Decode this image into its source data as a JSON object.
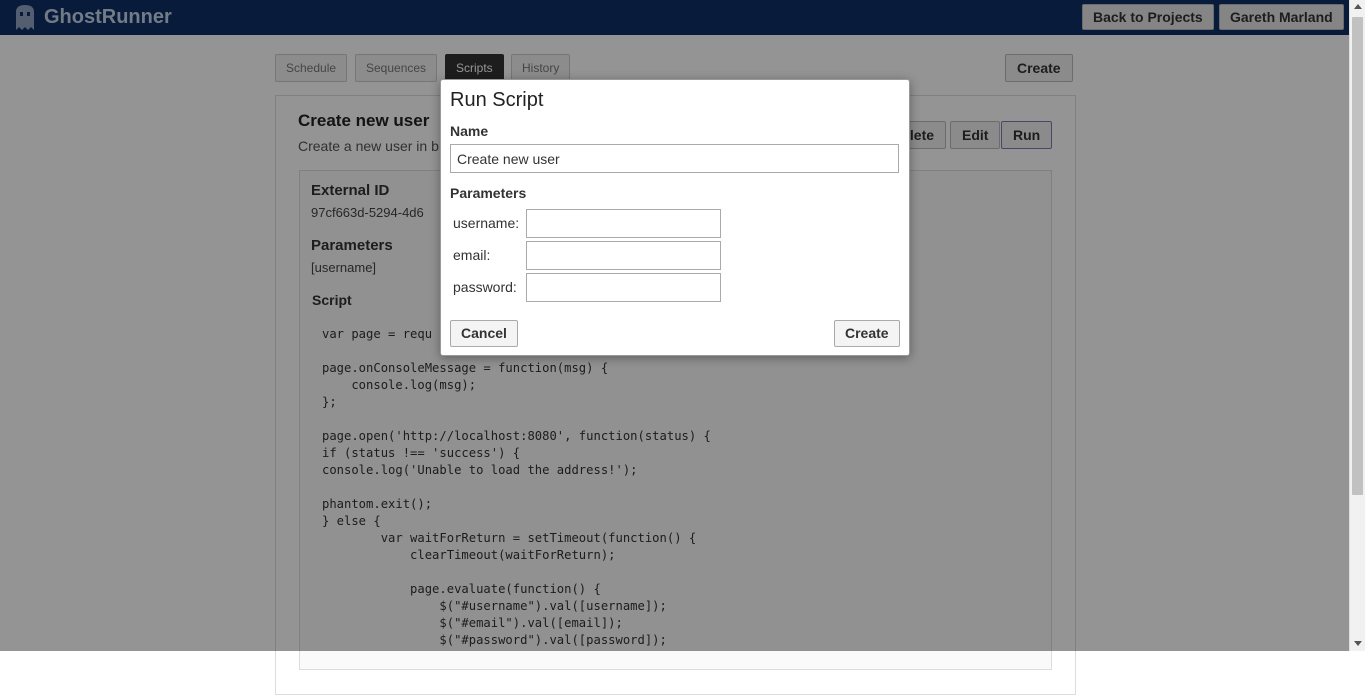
{
  "header": {
    "app_name": "GhostRunner",
    "back_label": "Back to Projects",
    "user_label": "Gareth Marland"
  },
  "tabs": [
    "Schedule",
    "Sequences",
    "Scripts",
    "History"
  ],
  "actions": {
    "create_label": "Create",
    "delete_label": "Delete",
    "edit_label": "Edit",
    "run_label": "Run"
  },
  "script": {
    "title": "Create new user",
    "description": "Create a new user in b",
    "external_id_label": "External ID",
    "external_id": "97cf663d-5294-4d6",
    "parameters_label": "Parameters",
    "parameters_value": "[username]",
    "script_label": "Script",
    "code": "var page = requ\n\npage.onConsoleMessage = function(msg) {\n    console.log(msg);\n};\n\npage.open('http://localhost:8080', function(status) {\nif (status !== 'success') {\nconsole.log('Unable to load the address!');\n\nphantom.exit();\n} else {\n        var waitForReturn = setTimeout(function() {\n            clearTimeout(waitForReturn);\n\n            page.evaluate(function() {\n                $(\"#username\").val([username]);\n                $(\"#email\").val([email]);\n                $(\"#password\").val([password]);"
  },
  "modal": {
    "title": "Run Script",
    "name_label": "Name",
    "name_value": "Create new user",
    "parameters_label": "Parameters",
    "params": [
      {
        "label": "username:",
        "value": ""
      },
      {
        "label": "email:",
        "value": ""
      },
      {
        "label": "password:",
        "value": ""
      }
    ],
    "cancel_label": "Cancel",
    "create_label": "Create"
  },
  "colors": {
    "header_bg": "#0f3066",
    "active_tab": "#333333",
    "overlay": "rgba(0,0,0,0.42)"
  },
  "icons": {
    "logo": "ghost-icon"
  }
}
